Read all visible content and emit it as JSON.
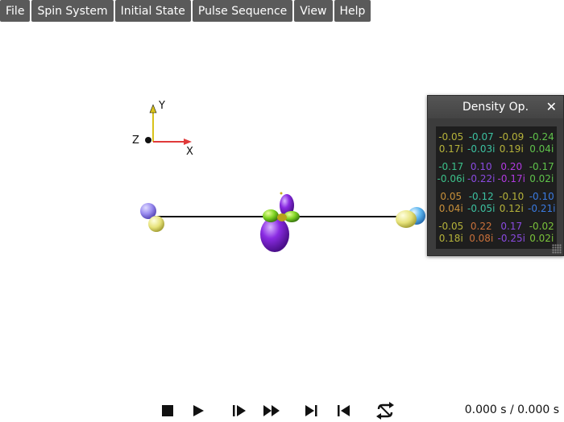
{
  "menu": {
    "items": [
      "File",
      "Spin System",
      "Initial State",
      "Pulse Sequence",
      "View",
      "Help"
    ]
  },
  "axes": {
    "x": "X",
    "y": "Y",
    "z": "Z"
  },
  "density_panel": {
    "title": "Density Op.",
    "close_icon": "close-icon",
    "matrix": [
      [
        {
          "re": "-0.05",
          "im": "0.17i",
          "color": "#b5b23a"
        },
        {
          "re": "-0.07",
          "im": "-0.03i",
          "color": "#3cc0a0"
        },
        {
          "re": "-0.09",
          "im": "0.19i",
          "color": "#b5b23a"
        },
        {
          "re": "-0.24",
          "im": "0.04i",
          "color": "#5fc24a"
        }
      ],
      [
        {
          "re": "-0.17",
          "im": "-0.06i",
          "color": "#3cc08a"
        },
        {
          "re": "0.10",
          "im": "-0.22i",
          "color": "#8a4ae0"
        },
        {
          "re": "0.20",
          "im": "-0.17i",
          "color": "#b03ae0"
        },
        {
          "re": "-0.17",
          "im": "0.02i",
          "color": "#5fc24a"
        }
      ],
      [
        {
          "re": "0.05",
          "im": "0.04i",
          "color": "#c8903a"
        },
        {
          "re": "-0.12",
          "im": "-0.05i",
          "color": "#3cc0a0"
        },
        {
          "re": "-0.10",
          "im": "0.12i",
          "color": "#b5b23a"
        },
        {
          "re": "-0.10",
          "im": "-0.21i",
          "color": "#3a7ae0"
        }
      ],
      [
        {
          "re": "-0.05",
          "im": "0.18i",
          "color": "#b5b23a"
        },
        {
          "re": "0.22",
          "im": "0.08i",
          "color": "#c8703a"
        },
        {
          "re": "0.17",
          "im": "-0.25i",
          "color": "#8a4ae0"
        },
        {
          "re": "-0.02",
          "im": "0.02i",
          "color": "#7ac23a"
        }
      ]
    ]
  },
  "playback": {
    "buttons": [
      "stop-icon",
      "play-icon",
      "step-forward-icon",
      "fast-forward-icon",
      "skip-to-end-icon",
      "skip-to-start-icon",
      "loop-icon"
    ],
    "time": "0.000 s / 0.000 s"
  }
}
